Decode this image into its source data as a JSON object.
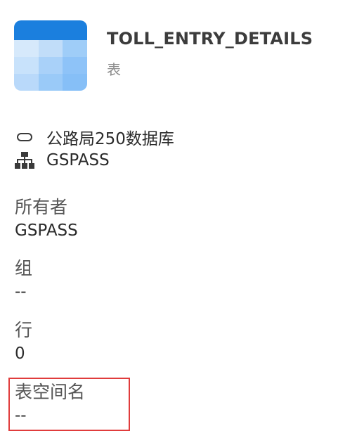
{
  "header": {
    "icon": "table-icon",
    "title": "TOLL_ENTRY_DETAILS",
    "type_label": "表"
  },
  "meta": {
    "database": {
      "icon": "database-icon",
      "text": "公路局250数据库"
    },
    "schema": {
      "icon": "schema-hierarchy-icon",
      "text": "GSPASS"
    }
  },
  "fields": {
    "owner": {
      "label": "所有者",
      "value": "GSPASS"
    },
    "group": {
      "label": "组",
      "value": "--"
    },
    "rows": {
      "label": "行",
      "value": "0"
    },
    "tablespace": {
      "label": "表空间名",
      "value": "--"
    }
  },
  "colors": {
    "accent": "#1b7fde",
    "highlight_border": "#e03c3c"
  }
}
